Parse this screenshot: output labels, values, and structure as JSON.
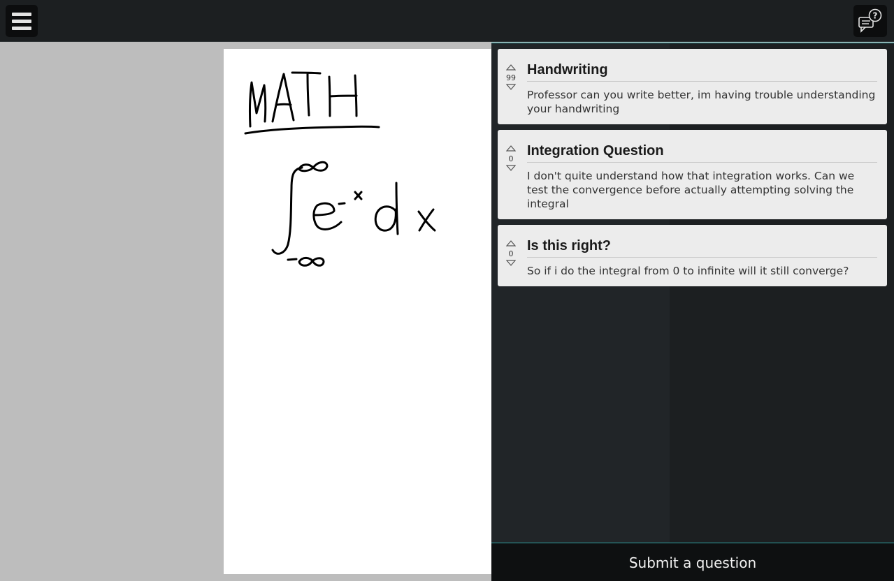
{
  "header": {
    "menu_icon": "hamburger-menu-icon",
    "help_icon": "chat-question-icon"
  },
  "whiteboard": {
    "heading_text": "MATH",
    "equation_text": "∫ from -∞ to ∞ of e^-x dx"
  },
  "questions": [
    {
      "votes": "99",
      "title": "Handwriting",
      "body": "Professor can you write better, im having trouble understanding your handwriting"
    },
    {
      "votes": "0",
      "title": "Integration Question",
      "body": "I don't quite understand how that integration works. Can we test the convergence before actually attempting solving the integral"
    },
    {
      "votes": "0",
      "title": "Is this right?",
      "body": "So if i do the integral from 0 to infinite will it still converge?"
    }
  ],
  "submit": {
    "label": "Submit a question"
  },
  "colors": {
    "accent": "#2fa3a3",
    "topbar": "#1c1f21",
    "card": "#ececec",
    "canvas": "#bdbdbd"
  }
}
